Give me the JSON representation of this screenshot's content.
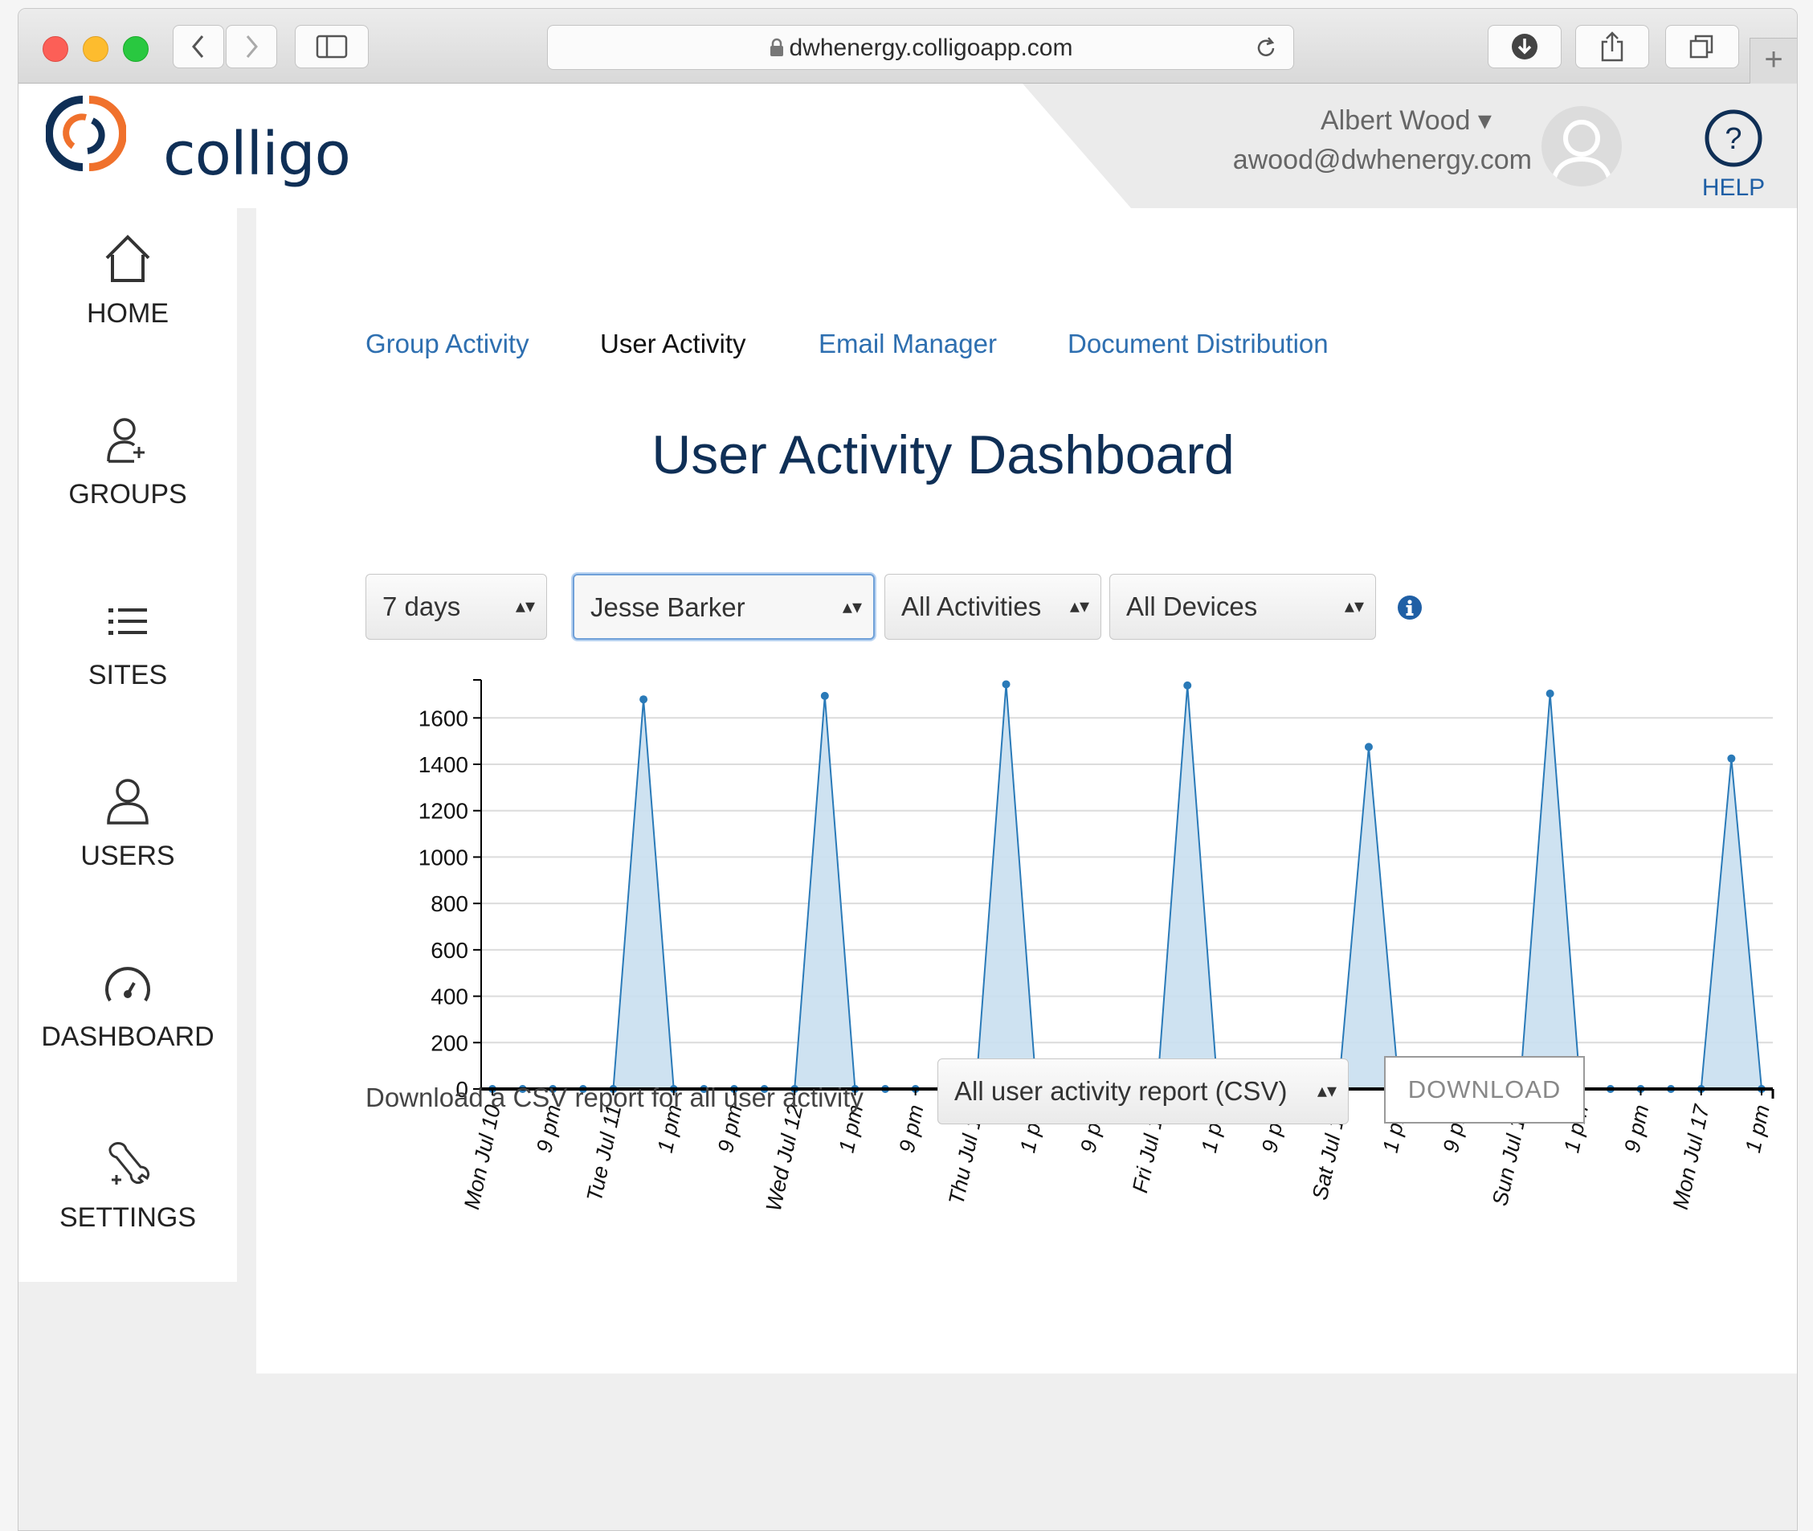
{
  "browser": {
    "url": "dwhenergy.colligoapp.com"
  },
  "brand": {
    "name": "colligo",
    "navy": "#0f2f56",
    "orange": "#f0712c",
    "link_blue": "#2e6fb0"
  },
  "header": {
    "user_name": "Albert Wood",
    "user_caret": "▾",
    "user_email": "awood@dwhenergy.com",
    "help_symbol": "?",
    "help_label": "HELP"
  },
  "sidebar": {
    "items": [
      {
        "label": "HOME",
        "icon": "home-icon"
      },
      {
        "label": "GROUPS",
        "icon": "add-user-icon"
      },
      {
        "label": "SITES",
        "icon": "list-icon"
      },
      {
        "label": "USERS",
        "icon": "user-icon"
      },
      {
        "label": "DASHBOARD",
        "icon": "gauge-icon"
      },
      {
        "label": "SETTINGS",
        "icon": "wrench-icon"
      }
    ]
  },
  "tabs": [
    {
      "label": "Group Activity",
      "active": false
    },
    {
      "label": "User Activity",
      "active": true
    },
    {
      "label": "Email Manager",
      "active": false
    },
    {
      "label": "Document Distribution",
      "active": false
    }
  ],
  "title": "User Activity Dashboard",
  "filters": {
    "period": "7 days",
    "user": "Jesse Barker",
    "activity": "All Activities",
    "device": "All Devices",
    "select_arrows": "▴▾"
  },
  "csv": {
    "label": "Download a CSV report for all user activity",
    "report": "All user activity report (CSV)",
    "button": "DOWNLOAD"
  },
  "chart_data": {
    "type": "area",
    "title": "",
    "xlabel": "",
    "ylabel": "",
    "ylim": [
      0,
      1750
    ],
    "yticks": [
      0,
      200,
      400,
      600,
      800,
      1000,
      1200,
      1400,
      1600
    ],
    "grid": true,
    "color": "#2a7ab8",
    "fill": "#c9dff0",
    "x_tick_labels": [
      "Mon Jul 10",
      "9 pm",
      "Tue Jul 11",
      "1 pm",
      "9 pm",
      "Wed Jul 12",
      "1 pm",
      "9 pm",
      "Thu Jul 13",
      "1 pm",
      "9 pm",
      "Fri Jul 14",
      "1 pm",
      "9 pm",
      "Sat Jul 15",
      "1 pm",
      "9 pm",
      "Sun Jul 16",
      "1 pm",
      "9 pm",
      "Mon Jul 17",
      "1 pm"
    ],
    "x_tick_slots": [
      0,
      2,
      4,
      6,
      8,
      10,
      12,
      14,
      16,
      18,
      20,
      22,
      24,
      26,
      28,
      30,
      32,
      34,
      36,
      38,
      40,
      42
    ],
    "values": [
      0,
      0,
      0,
      0,
      0,
      1680,
      0,
      0,
      0,
      0,
      0,
      1695,
      0,
      0,
      0,
      0,
      0,
      1745,
      0,
      0,
      0,
      0,
      0,
      1740,
      0,
      0,
      0,
      0,
      0,
      1475,
      0,
      0,
      0,
      0,
      0,
      1705,
      0,
      0,
      0,
      0,
      0,
      1425,
      0
    ]
  }
}
